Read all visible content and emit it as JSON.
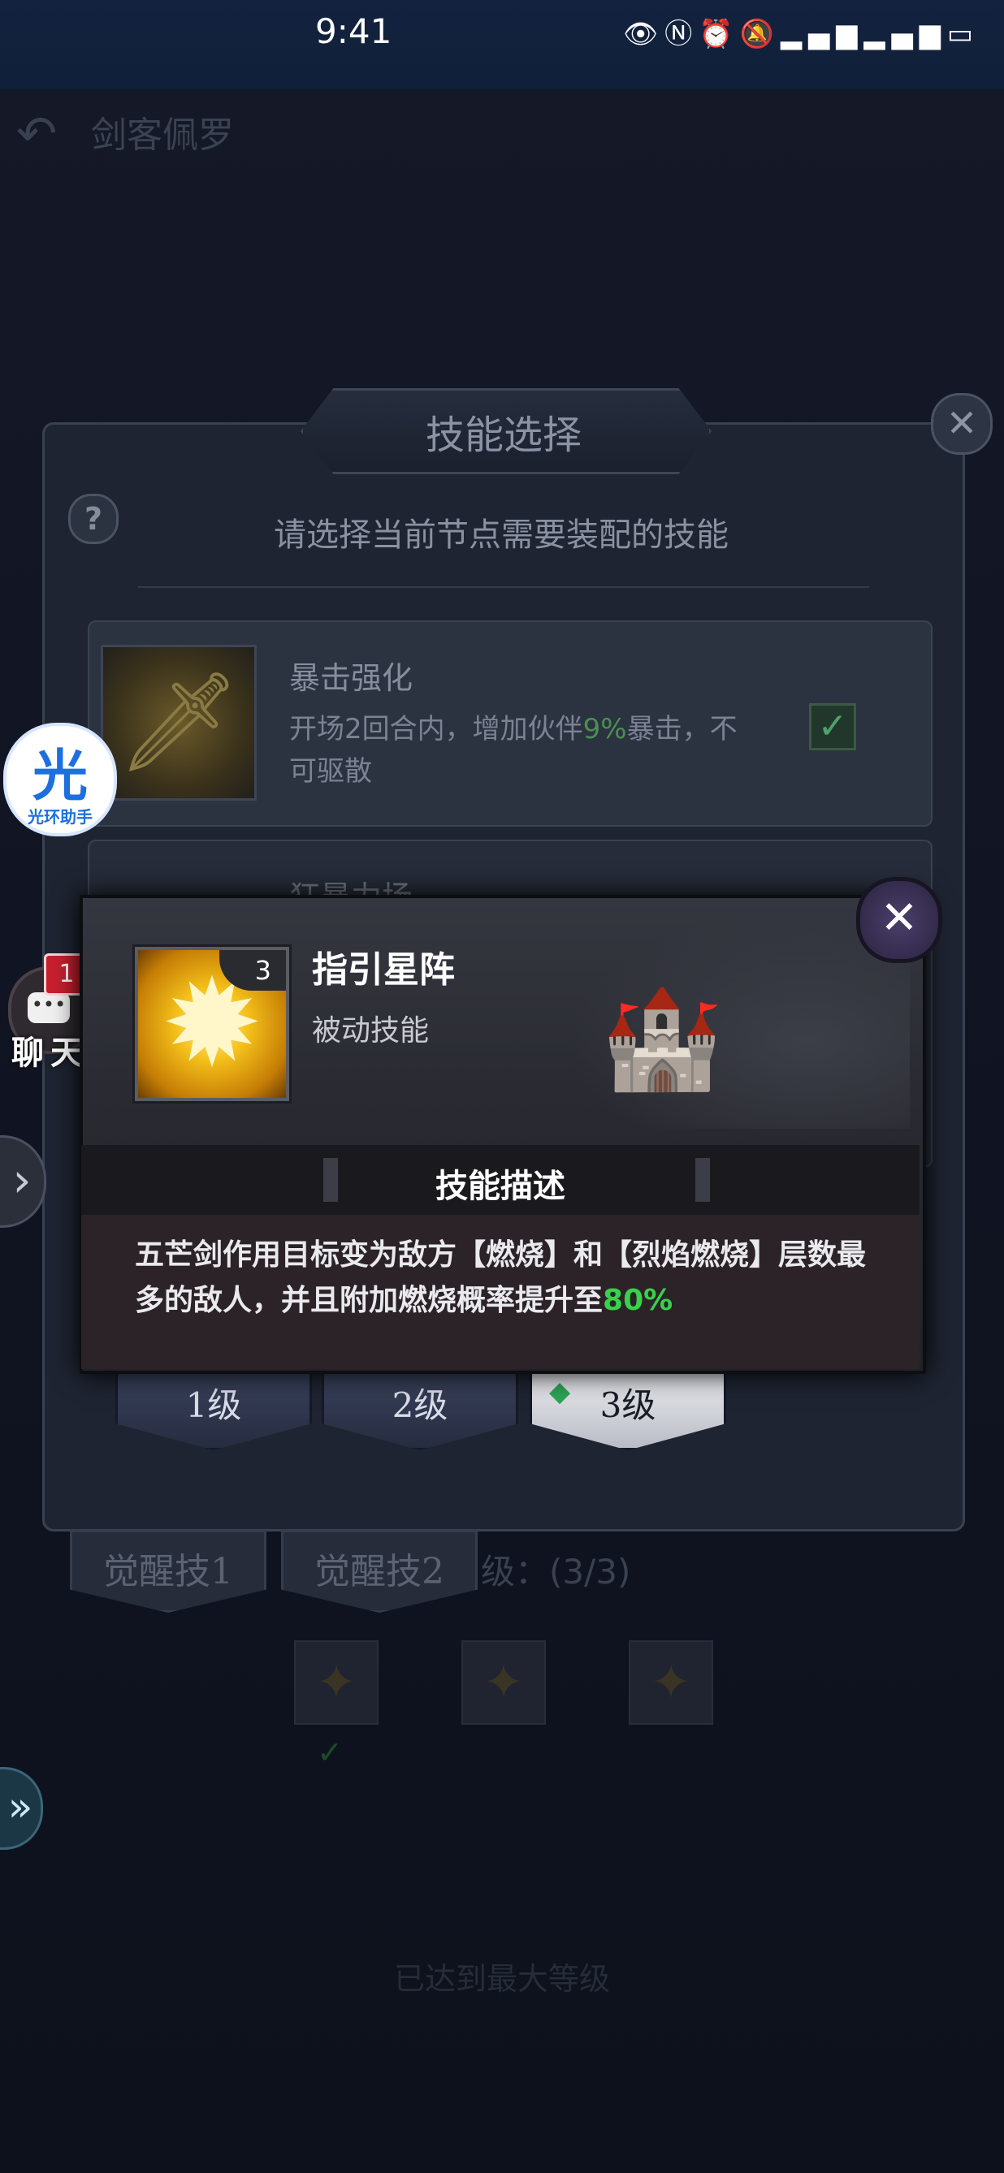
{
  "status_bar": {
    "time": "9:41",
    "icons": [
      "eye-icon",
      "nfc-icon",
      "alarm-icon",
      "mute-icon",
      "signal-4g-icon",
      "signal-4g-icon",
      "battery-icon"
    ]
  },
  "background_page": {
    "title": "剑客佩罗",
    "awakening_tabs": [
      "觉醒技1",
      "觉醒技2"
    ],
    "awakening_level": "级：(3/3)",
    "max_level_text": "已达到最大等级"
  },
  "skill_dialog": {
    "title": "技能选择",
    "prompt": "请选择当前节点需要装配的技能",
    "skills": [
      {
        "name": "暴击强化",
        "desc_before": "开场2回合内，增加伙伴",
        "desc_highlight": "9%",
        "desc_after": "暴击，不可驱散",
        "checked": true
      },
      {
        "name": "狂暴力场"
      }
    ],
    "levels": [
      "1级",
      "2级",
      "3级"
    ],
    "active_level": "3级"
  },
  "popup": {
    "skill_name": "指引星阵",
    "skill_type": "被动技能",
    "level_badge": "3",
    "section_title": "技能描述",
    "desc_before": "五芒剑作用目标变为敌方【燃烧】和【烈焰燃烧】层数最多的敌人，并且附加燃烧概率提升至",
    "desc_highlight": "80%",
    "highlight_color": "#39d14b"
  },
  "side_widgets": {
    "assistant_big": "光",
    "assistant_small": "光环助手",
    "chat_label": "聊天",
    "chat_badge": "1"
  }
}
